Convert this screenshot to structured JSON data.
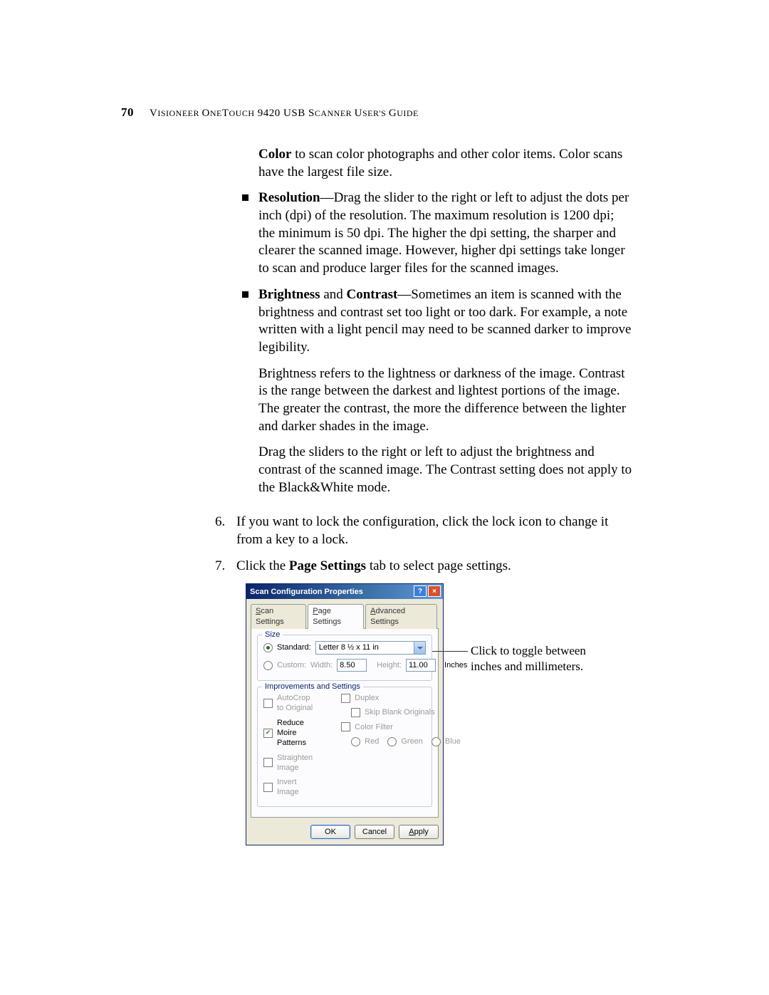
{
  "header": {
    "page_number": "70",
    "title_pre": "V",
    "title_rest": "ISIONEER ",
    "title_2a": "O",
    "title_2b": "NE",
    "title_2c": "T",
    "title_2d": "OUCH",
    "title_model": " 9420 USB S",
    "title_sc": "CANNER ",
    "title_ug1": "U",
    "title_ug2": "SER'S ",
    "title_ug3": "G",
    "title_ug4": "UIDE"
  },
  "body": {
    "p_color_a": "Color",
    "p_color_b": " to scan color photographs and other color items. Color scans have the largest file size.",
    "bul_res_a": "Resolution",
    "bul_res_b": "—Drag the slider to the right or left to adjust the dots per inch (dpi) of the resolution. The maximum resolution is 1200 dpi; the minimum is 50 dpi. The higher the dpi setting, the sharper and clearer the scanned image. However, higher dpi settings take longer to scan and produce larger files for the scanned images.",
    "bul_bc_a": "Brightness",
    "bul_bc_mid": " and ",
    "bul_bc_b": "Contrast",
    "bul_bc_c": "—Sometimes an item is scanned with the brightness and contrast set too light or too dark. For example, a note written with a light pencil may need to be scanned darker to improve legibility.",
    "bul_bc_p2": "Brightness refers to the lightness or darkness of the image. Contrast is the range between the darkest and lightest portions of the image. The greater the contrast, the more the difference between the lighter and darker shades in the image.",
    "bul_bc_p3": "Drag the sliders to the right or left to adjust the brightness and contrast of the scanned image. The Contrast setting does not apply to the Black&White mode.",
    "step6_n": "6.",
    "step6": "If you want to lock the configuration, click the lock icon to change it from a key to a lock.",
    "step7_n": "7.",
    "step7_a": "Click the ",
    "step7_b": "Page Settings",
    "step7_c": " tab to select page settings."
  },
  "dialog": {
    "title": "Scan Configuration Properties",
    "tabs": {
      "scan": "Scan Settings",
      "page": "Page Settings",
      "adv": "Advanced Settings"
    },
    "size": {
      "legend": "Size",
      "standard": "Standard:",
      "standard_value": "Letter 8 ½ x 11 in",
      "custom": "Custom:",
      "width_lbl": "Width:",
      "width_val": "8.50",
      "height_lbl": "Height:",
      "height_val": "11.00",
      "units": "Inches"
    },
    "imp": {
      "legend": "Improvements and Settings",
      "autocrop": "AutoCrop to Original",
      "moire": "Reduce Moire Patterns",
      "straighten": "Straighten Image",
      "invert": "Invert Image",
      "duplex": "Duplex",
      "skip": "Skip Blank Originals",
      "colorfilter": "Color Filter",
      "red": "Red",
      "green": "Green",
      "blue": "Blue"
    },
    "buttons": {
      "ok": "OK",
      "cancel": "Cancel",
      "apply": "Apply"
    }
  },
  "callout": "Click to toggle between inches and millimeters."
}
